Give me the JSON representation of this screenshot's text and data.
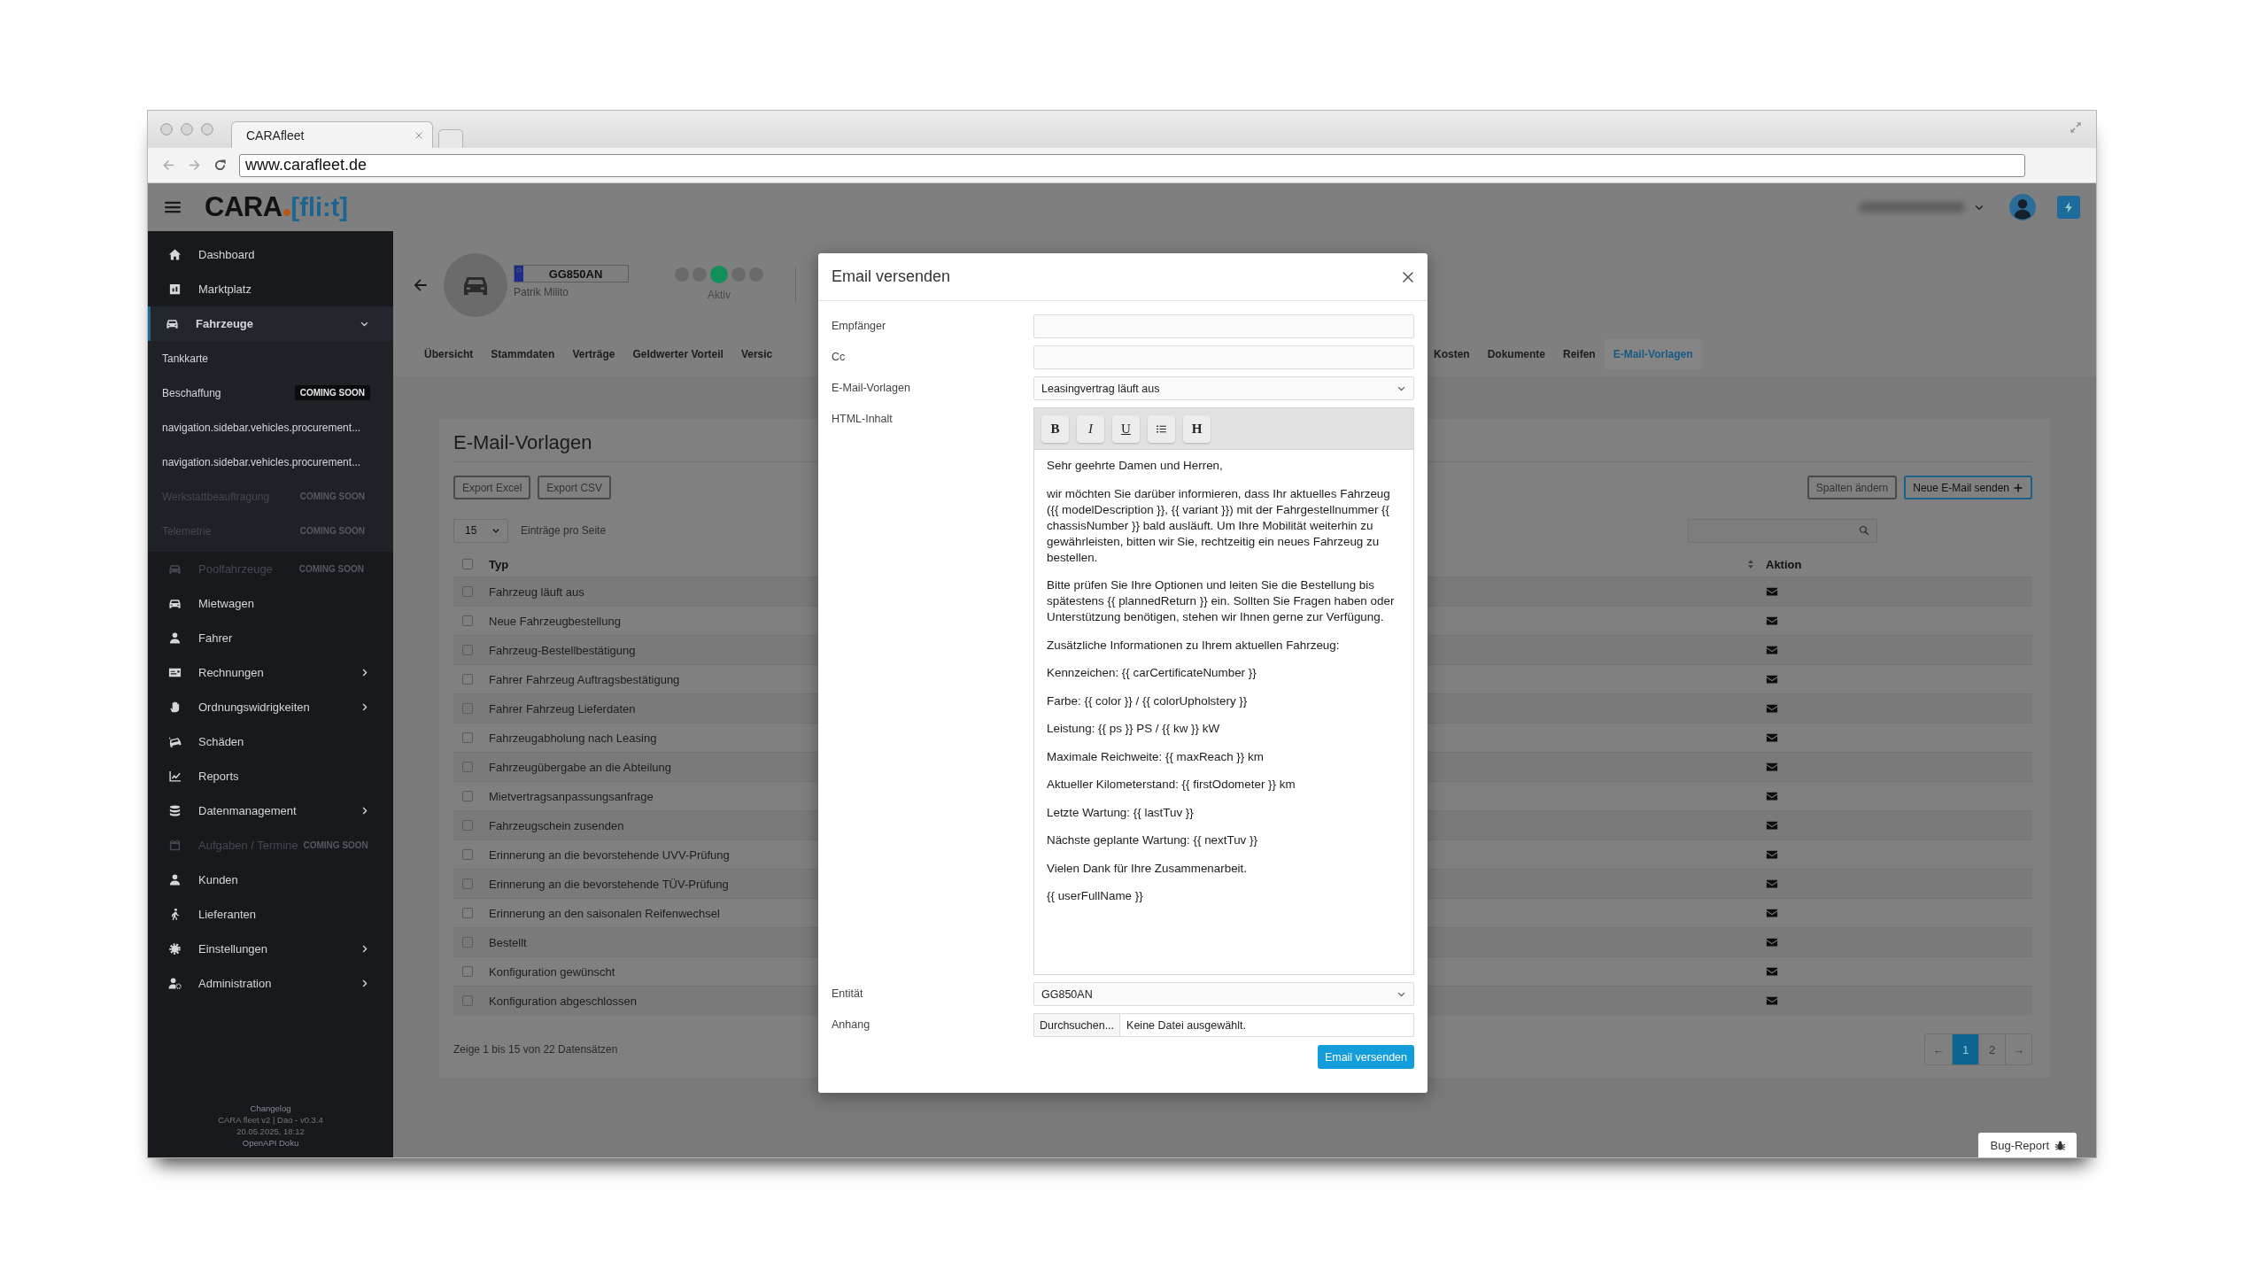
{
  "browser": {
    "tab_title": "CARAfleet",
    "url": "www.carafleet.de"
  },
  "header": {
    "logo": {
      "word": "CARA",
      "mark": "[fli:t]"
    }
  },
  "sidebar": {
    "items": [
      {
        "label": "Dashboard",
        "selected": false,
        "disabled": false
      },
      {
        "label": "Marktplatz",
        "selected": false,
        "disabled": false
      },
      {
        "label": "Fahrzeuge",
        "selected": true,
        "disabled": false,
        "expanded": true,
        "children": [
          {
            "label": "Tankkarte",
            "selected": false,
            "disabled": false
          },
          {
            "label": "Beschaffung",
            "selected": false,
            "disabled": false,
            "badge": "COMING SOON"
          },
          {
            "label": "navigation.sidebar.vehicles.procurement...",
            "selected": false,
            "disabled": false
          },
          {
            "label": "navigation.sidebar.vehicles.procurement...",
            "selected": false,
            "disabled": false
          },
          {
            "label": "Werkstattbeauftragung",
            "selected": false,
            "disabled": true,
            "badge": "COMING SOON"
          },
          {
            "label": "Telemetrie",
            "selected": false,
            "disabled": true,
            "badge": "COMING SOON"
          }
        ]
      },
      {
        "label": "Poolfahrzeuge",
        "selected": false,
        "disabled": true,
        "badge": "COMING SOON"
      },
      {
        "label": "Mietwagen",
        "selected": false,
        "disabled": false
      },
      {
        "label": "Fahrer",
        "selected": false,
        "disabled": false
      },
      {
        "label": "Rechnungen",
        "selected": false,
        "disabled": false,
        "expanded": false
      },
      {
        "label": "Ordnungswidrigkeiten",
        "selected": false,
        "disabled": false,
        "expanded": false
      },
      {
        "label": "Schäden",
        "selected": false,
        "disabled": false
      },
      {
        "label": "Reports",
        "selected": false,
        "disabled": false
      },
      {
        "label": "Datenmanagement",
        "selected": false,
        "disabled": false,
        "expanded": false
      },
      {
        "label": "Aufgaben / Termine",
        "selected": false,
        "disabled": true,
        "badge": "COMING SOON"
      },
      {
        "label": "Kunden",
        "selected": false,
        "disabled": false
      },
      {
        "label": "Lieferanten",
        "selected": false,
        "disabled": false
      },
      {
        "label": "Einstellungen",
        "selected": false,
        "disabled": false,
        "expanded": false
      },
      {
        "label": "Administration",
        "selected": false,
        "disabled": false,
        "expanded": false
      }
    ],
    "footer": [
      {
        "kind": "link",
        "text": "Changelog"
      },
      {
        "kind": "text",
        "text": "CARA fleet v2 | Dao - v0.3.4"
      },
      {
        "kind": "text",
        "text": "20.05.2025, 18:12"
      },
      {
        "kind": "link",
        "text": "OpenAPI Doku"
      }
    ]
  },
  "vehicle": {
    "plate": "GG850AN",
    "driver": "Patrik Milito",
    "status": {
      "label": "Aktiv",
      "steps": [
        {
          "selected": false
        },
        {
          "selected": false
        },
        {
          "selected": true
        },
        {
          "selected": false
        },
        {
          "selected": false
        }
      ]
    }
  },
  "tabs_before_dialog": [
    {
      "label": "Übersicht",
      "selected": false
    },
    {
      "label": "Stammdaten",
      "selected": false
    },
    {
      "label": "Verträge",
      "selected": false
    },
    {
      "label": "Geldwerter Vorteil",
      "selected": false
    },
    {
      "label": "Versic",
      "selected": false
    }
  ],
  "tabs_after_dialog": [
    {
      "label": "Kosten",
      "selected": false
    },
    {
      "label": "Dokumente",
      "selected": false
    },
    {
      "label": "Reifen",
      "selected": false
    },
    {
      "label": "E-Mail-Vorlagen",
      "selected": true
    }
  ],
  "content": {
    "title": "E-Mail-Vorlagen",
    "export_buttons": [
      "Export Excel",
      "Export CSV"
    ],
    "actions": [
      {
        "label": "Spalten ändern",
        "kind": "secondary"
      },
      {
        "label": "Neue E-Mail senden",
        "kind": "primary"
      }
    ],
    "page_size": "15",
    "page_size_label": "Einträge pro Seite",
    "table": {
      "select_all": {
        "checked": false
      },
      "columns": [
        "Typ",
        "Aktion"
      ],
      "rows": [
        {
          "type": "Fahrzeug läuft aus",
          "checked": false
        },
        {
          "type": "Neue Fahrzeugbestellung",
          "checked": false
        },
        {
          "type": "Fahrzeug-Bestellbestätigung",
          "checked": false
        },
        {
          "type": "Fahrer Fahrzeug Auftragsbestätigung",
          "checked": false
        },
        {
          "type": "Fahrer Fahrzeug Lieferdaten",
          "checked": false
        },
        {
          "type": "Fahrzeugabholung nach Leasing",
          "checked": false
        },
        {
          "type": "Fahrzeugübergabe an die Abteilung",
          "checked": false
        },
        {
          "type": "Mietvertragsanpassungsanfrage",
          "checked": false
        },
        {
          "type": "Fahrzeugschein zusenden",
          "checked": false
        },
        {
          "type": "Erinnerung an die bevorstehende UVV-Prüfung",
          "checked": false
        },
        {
          "type": "Erinnerung an die bevorstehende TÜV-Prüfung",
          "checked": false
        },
        {
          "type": "Erinnerung an den saisonalen Reifenwechsel",
          "checked": false
        },
        {
          "type": "Bestellt",
          "checked": false
        },
        {
          "type": "Konfiguration gewünscht",
          "checked": false
        },
        {
          "type": "Konfiguration abgeschlossen",
          "checked": false
        }
      ]
    },
    "footer": "Zeige 1 bis 15 von 22 Datensätzen",
    "pagination": [
      {
        "label": "←",
        "selected": false
      },
      {
        "label": "1",
        "selected": true
      },
      {
        "label": "2",
        "selected": false
      },
      {
        "label": "→",
        "selected": false
      }
    ]
  },
  "dialog": {
    "title": "Email versenden",
    "fields": [
      {
        "kind": "text",
        "label": "Empfänger"
      },
      {
        "kind": "text",
        "label": "Cc"
      },
      {
        "kind": "select",
        "label": "E-Mail-Vorlagen",
        "value": "Leasingvertrag läuft aus"
      },
      {
        "kind": "editor",
        "label": "HTML-Inhalt",
        "toolbar": [
          {
            "kind": "text",
            "label": "B"
          },
          {
            "kind": "text",
            "label": "I"
          },
          {
            "kind": "text",
            "label": "U"
          },
          {
            "kind": "icon"
          },
          {
            "kind": "text",
            "label": "H"
          }
        ],
        "paragraphs": [
          "Sehr geehrte Damen und Herren,",
          "wir möchten Sie darüber informieren, dass Ihr aktuelles Fahrzeug ({{ modelDescription }}, {{ variant }}) mit der Fahrgestellnummer {{ chassisNumber }} bald ausläuft. Um Ihre Mobilität weiterhin zu gewährleisten, bitten wir Sie, rechtzeitig ein neues Fahrzeug zu bestellen.",
          "Bitte prüfen Sie Ihre Optionen und leiten Sie die Bestellung bis spätestens {{ plannedReturn }} ein. Sollten Sie Fragen haben oder Unterstützung benötigen, stehen wir Ihnen gerne zur Verfügung.",
          "Zusätzliche Informationen zu Ihrem aktuellen Fahrzeug:",
          "Kennzeichen: {{ carCertificateNumber }}",
          "Farbe: {{ color }} / {{ colorUpholstery }}",
          "Leistung: {{ ps }} PS / {{ kw }} kW",
          "Maximale Reichweite: {{ maxReach }} km",
          "Aktueller Kilometerstand: {{ firstOdometer }} km",
          "Letzte Wartung: {{ lastTuv }}",
          "Nächste geplante Wartung: {{ nextTuv }}",
          "Vielen Dank für Ihre Zusammenarbeit.",
          "{{ userFullName }}"
        ]
      },
      {
        "kind": "select",
        "label": "Entität",
        "value": "GG850AN"
      },
      {
        "kind": "file",
        "label": "Anhang",
        "button": "Durchsuchen...",
        "value": "Keine Datei ausgewählt."
      }
    ],
    "submit": "Email versenden"
  },
  "bug_report": "Bug-Report"
}
